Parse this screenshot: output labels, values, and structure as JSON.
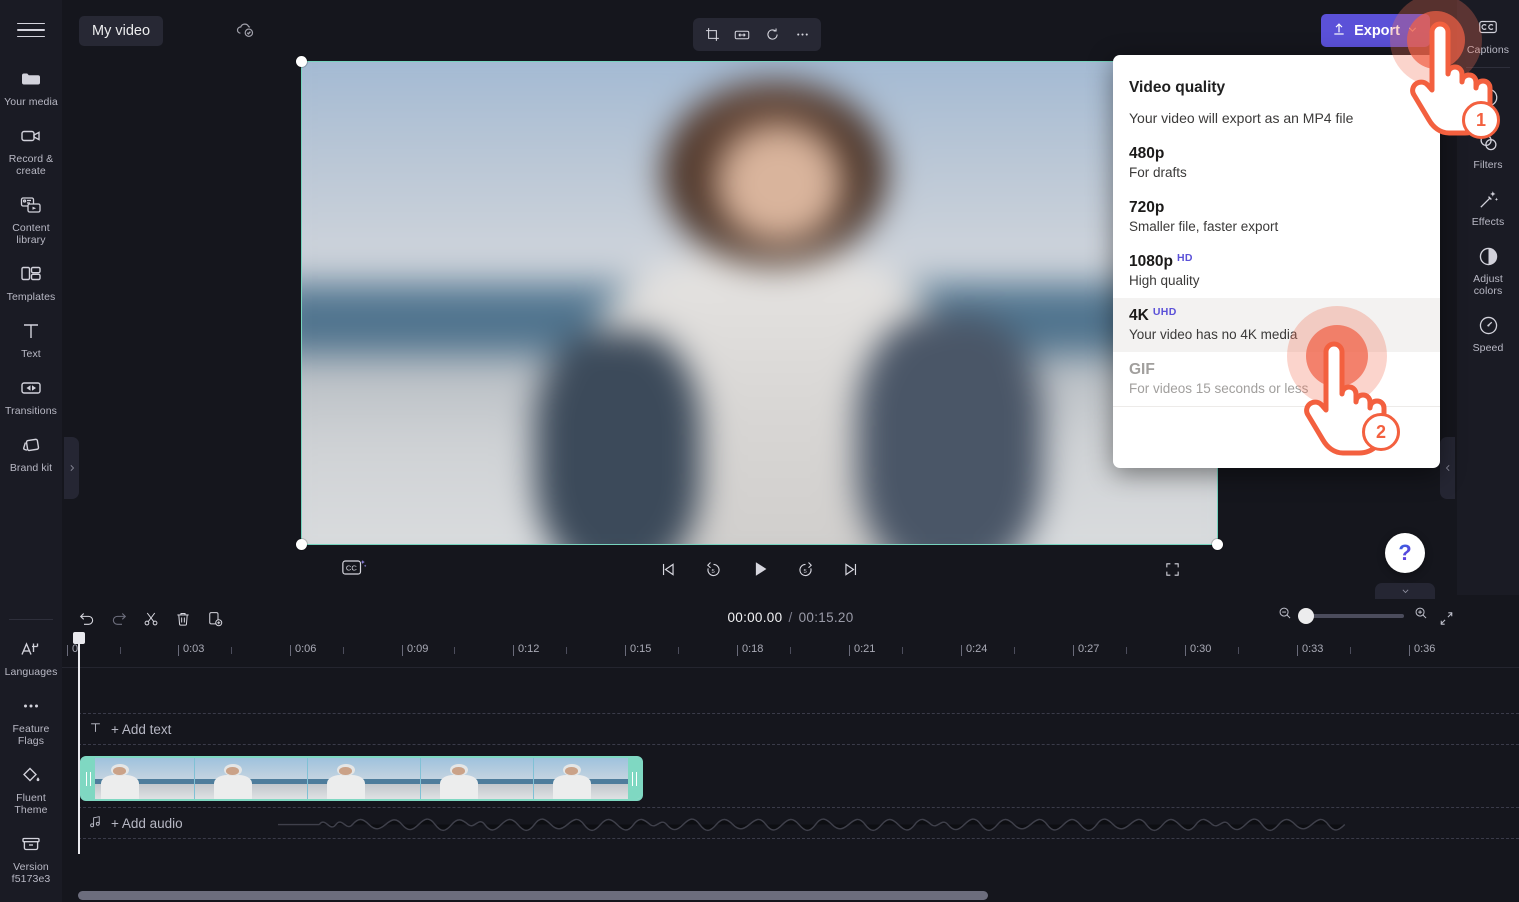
{
  "app": {
    "project_name": "My video",
    "saved_status_icon": "cloud-saved-icon"
  },
  "left_rail": {
    "menu_icon": "hamburger-menu-icon",
    "items": [
      {
        "label": "Your media",
        "icon": "folder-icon"
      },
      {
        "label": "Record & create",
        "icon": "video-camera-icon"
      },
      {
        "label": "Content library",
        "icon": "content-library-icon"
      },
      {
        "label": "Templates",
        "icon": "templates-grid-icon"
      },
      {
        "label": "Text",
        "icon": "text-t-icon"
      },
      {
        "label": "Transitions",
        "icon": "transitions-icon"
      },
      {
        "label": "Brand kit",
        "icon": "brand-kit-icon"
      }
    ],
    "bottom_items": [
      {
        "label": "Languages",
        "icon": "languages-icon"
      },
      {
        "label": "Feature Flags",
        "icon": "ellipsis-icon"
      },
      {
        "label": "Fluent Theme",
        "icon": "paint-bucket-icon"
      },
      {
        "label": "Version f5173e3",
        "icon": "archive-box-icon"
      }
    ]
  },
  "top_toolbar": {
    "tools": [
      {
        "name": "crop-tool",
        "icon": "crop-icon"
      },
      {
        "name": "fit-tool",
        "icon": "fit-width-icon"
      },
      {
        "name": "rotate-tool",
        "icon": "rotate-icon"
      },
      {
        "name": "more-tool",
        "icon": "ellipsis-icon"
      }
    ],
    "export_label": "Export",
    "export_icon": "upload-arrow-icon",
    "export_chevron": "chevron-down-icon",
    "export_color": "#5b51d8"
  },
  "right_rail": {
    "items": [
      {
        "label": "Captions",
        "icon": "cc-icon"
      },
      {
        "label": "",
        "icon": "fade-icon"
      },
      {
        "label": "Filters",
        "icon": "filters-circles-icon"
      },
      {
        "label": "Effects",
        "icon": "magic-wand-icon"
      },
      {
        "label": "Adjust colors",
        "icon": "contrast-half-circle-icon"
      },
      {
        "label": "Speed",
        "icon": "speedometer-icon"
      }
    ]
  },
  "export_menu": {
    "title": "Video quality",
    "subtitle": "Your video will export as an MP4 file",
    "options": [
      {
        "name": "480p",
        "badge": "",
        "desc": "For drafts",
        "state": "normal"
      },
      {
        "name": "720p",
        "badge": "",
        "desc": "Smaller file, faster export",
        "state": "normal"
      },
      {
        "name": "1080p",
        "badge": "HD",
        "desc": "High quality",
        "state": "normal"
      },
      {
        "name": "4K",
        "badge": "UHD",
        "desc": "Your video has no 4K media",
        "state": "highlighted"
      },
      {
        "name": "GIF",
        "badge": "",
        "desc": "For videos 15 seconds or less",
        "state": "disabled"
      }
    ],
    "badge_color": "#5b51d8"
  },
  "player": {
    "cc_button_icon": "cc-sparkle-icon",
    "transport": [
      {
        "name": "skip-to-start-button",
        "icon": "skip-previous-icon"
      },
      {
        "name": "rewind-5-button",
        "icon": "rewind-5-icon"
      },
      {
        "name": "play-button",
        "icon": "play-icon"
      },
      {
        "name": "forward-5-button",
        "icon": "forward-5-icon"
      },
      {
        "name": "skip-to-end-button",
        "icon": "skip-next-icon"
      }
    ],
    "fullscreen_icon": "fullscreen-icon"
  },
  "timeline": {
    "tools": [
      {
        "name": "undo-button",
        "icon": "undo-arrow-icon"
      },
      {
        "name": "redo-button",
        "icon": "redo-arrow-icon"
      },
      {
        "name": "split-button",
        "icon": "scissors-icon"
      },
      {
        "name": "delete-button",
        "icon": "trash-icon"
      },
      {
        "name": "duplicate-button",
        "icon": "duplicate-add-icon"
      }
    ],
    "current_time": "00:00.00",
    "separator": "/",
    "total_time": "00:15.20",
    "zoom_out_icon": "zoom-out-icon",
    "zoom_in_icon": "zoom-in-icon",
    "fit_timeline_icon": "collapse-diagonal-icon",
    "zoom_value": 4,
    "ruler_labels": [
      "0",
      "0:03",
      "0:06",
      "0:09",
      "0:12",
      "0:15",
      "0:18",
      "0:21",
      "0:24",
      "0:27",
      "0:30",
      "0:33",
      "0:36"
    ],
    "text_track_label": "+ Add text",
    "text_track_icon": "text-t-icon",
    "audio_track_label": "+ Add audio",
    "audio_track_icon": "music-note-icon"
  },
  "overlays": {
    "step_1": "1",
    "step_2": "2",
    "accent_color": "#f3603f",
    "help_label": "?"
  },
  "collapse": {
    "left_chevron": "chevron-right-icon",
    "right_chevron": "chevron-left-icon",
    "down_chevron": "chevron-down-icon"
  }
}
